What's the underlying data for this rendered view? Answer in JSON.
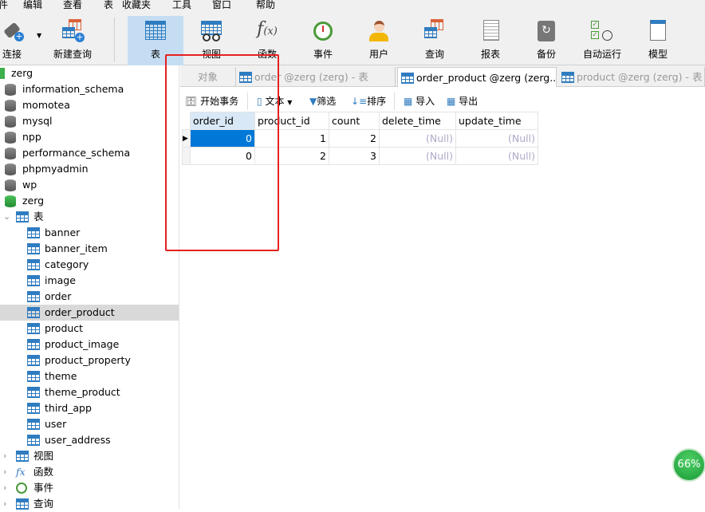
{
  "menu": [
    "件",
    "编辑",
    "查看",
    "表",
    "收藏夹",
    "工具",
    "窗口",
    "帮助"
  ],
  "toolbar": [
    {
      "label": "连接",
      "icon": "plug-connect-icon"
    },
    {
      "label": "新建查询",
      "icon": "new-query-icon"
    },
    {
      "label": "表",
      "icon": "table-icon",
      "selected": true
    },
    {
      "label": "视图",
      "icon": "view-icon"
    },
    {
      "label": "函数",
      "icon": "function-icon"
    },
    {
      "label": "事件",
      "icon": "alarm-clock-icon"
    },
    {
      "label": "用户",
      "icon": "user-icon"
    },
    {
      "label": "查询",
      "icon": "query-icon"
    },
    {
      "label": "报表",
      "icon": "report-icon"
    },
    {
      "label": "备份",
      "icon": "backup-icon"
    },
    {
      "label": "自动运行",
      "icon": "automation-icon"
    },
    {
      "label": "模型",
      "icon": "model-icon"
    }
  ],
  "sidebar": {
    "databases": [
      "zerg",
      "information_schema",
      "momotea",
      "mysql",
      "npp",
      "performance_schema",
      "phpmyadmin",
      "wp",
      "zerg"
    ],
    "tables_label": "表",
    "tables": [
      "banner",
      "banner_item",
      "category",
      "image",
      "order",
      "order_product",
      "product",
      "product_image",
      "product_property",
      "theme",
      "theme_product",
      "third_app",
      "user",
      "user_address"
    ],
    "selected_table": "order_product",
    "groups": [
      "视图",
      "函数",
      "事件",
      "查询"
    ]
  },
  "tabs": [
    {
      "label": "对象"
    },
    {
      "label": "order @zerg (zerg) - 表"
    },
    {
      "label": "order_product @zerg (zerg...",
      "active": true
    },
    {
      "label": "product @zerg (zerg) - 表"
    }
  ],
  "actions": {
    "begin_transaction": "开始事务",
    "text": "文本",
    "filter": "筛选",
    "sort": "排序",
    "import": "导入",
    "export": "导出"
  },
  "grid": {
    "columns": [
      "order_id",
      "product_id",
      "count",
      "delete_time",
      "update_time"
    ],
    "rows": [
      [
        "0",
        "1",
        "2",
        "(Null)",
        "(Null)"
      ],
      [
        "0",
        "2",
        "3",
        "(Null)",
        "(Null)"
      ]
    ]
  },
  "badge": "66%"
}
